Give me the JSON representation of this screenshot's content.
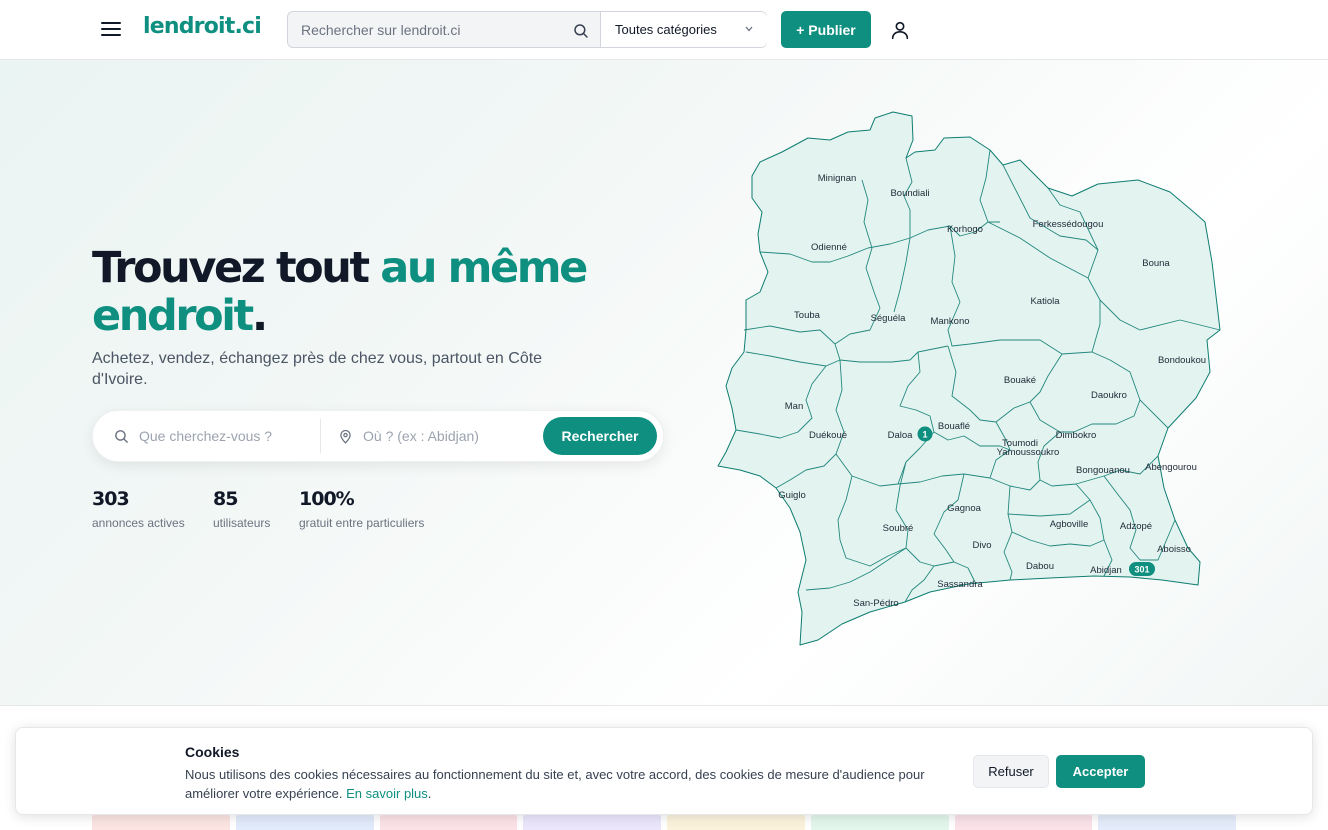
{
  "header": {
    "logo": "lendroit.ci",
    "search_placeholder": "Rechercher sur lendroit.ci",
    "category_selected": "Toutes catégories",
    "publish_label": "+ Publier"
  },
  "hero": {
    "title_dark": "Trouvez tout ",
    "title_accent": "au même endroit",
    "title_end": ".",
    "subtitle": "Achetez, vendez, échangez près de chez vous, partout en Côte d'Ivoire.",
    "search": {
      "what_placeholder": "Que cherchez-vous ?",
      "where_placeholder": "Où ? (ex : Abidjan)",
      "button_label": "Rechercher"
    },
    "stats": [
      {
        "value": "303",
        "label": "annonces actives"
      },
      {
        "value": "85",
        "label": "utilisateurs"
      },
      {
        "value": "100%",
        "label": "gratuit entre particuliers"
      }
    ]
  },
  "map": {
    "regions": [
      "Minignan",
      "Boundiali",
      "Korhogo",
      "Ferkessédougou",
      "Odienné",
      "Bouna",
      "Touba",
      "Séguéla",
      "Mankono",
      "Katiola",
      "Bondoukou",
      "Bouaké",
      "Man",
      "Daoukro",
      "Duékoué",
      "Daloa",
      "Bouaflé",
      "Toumodi",
      "Yamoussoukro",
      "Dimbokro",
      "Bongouanou",
      "Abengourou",
      "Guiglo",
      "Gagnoa",
      "Agboville",
      "Adzopé",
      "Soubré",
      "Divo",
      "Aboisso",
      "Dabou",
      "Abidjan",
      "Sassandra",
      "San-Pédro"
    ],
    "badges": {
      "daloa": "1",
      "abidjan": "301"
    }
  },
  "cookie": {
    "title": "Cookies",
    "text": "Nous utilisons des cookies nécessaires au fonctionnement du site et, avec votre accord, des cookies de mesure d'audience pour améliorer votre expérience. ",
    "link": "En savoir plus",
    "end": ".",
    "refuse": "Refuser",
    "accept": "Accepter"
  },
  "colors": {
    "brand": "#0e8f80",
    "map_fill": "#e3f3f0",
    "map_stroke": "#0e7d70"
  }
}
